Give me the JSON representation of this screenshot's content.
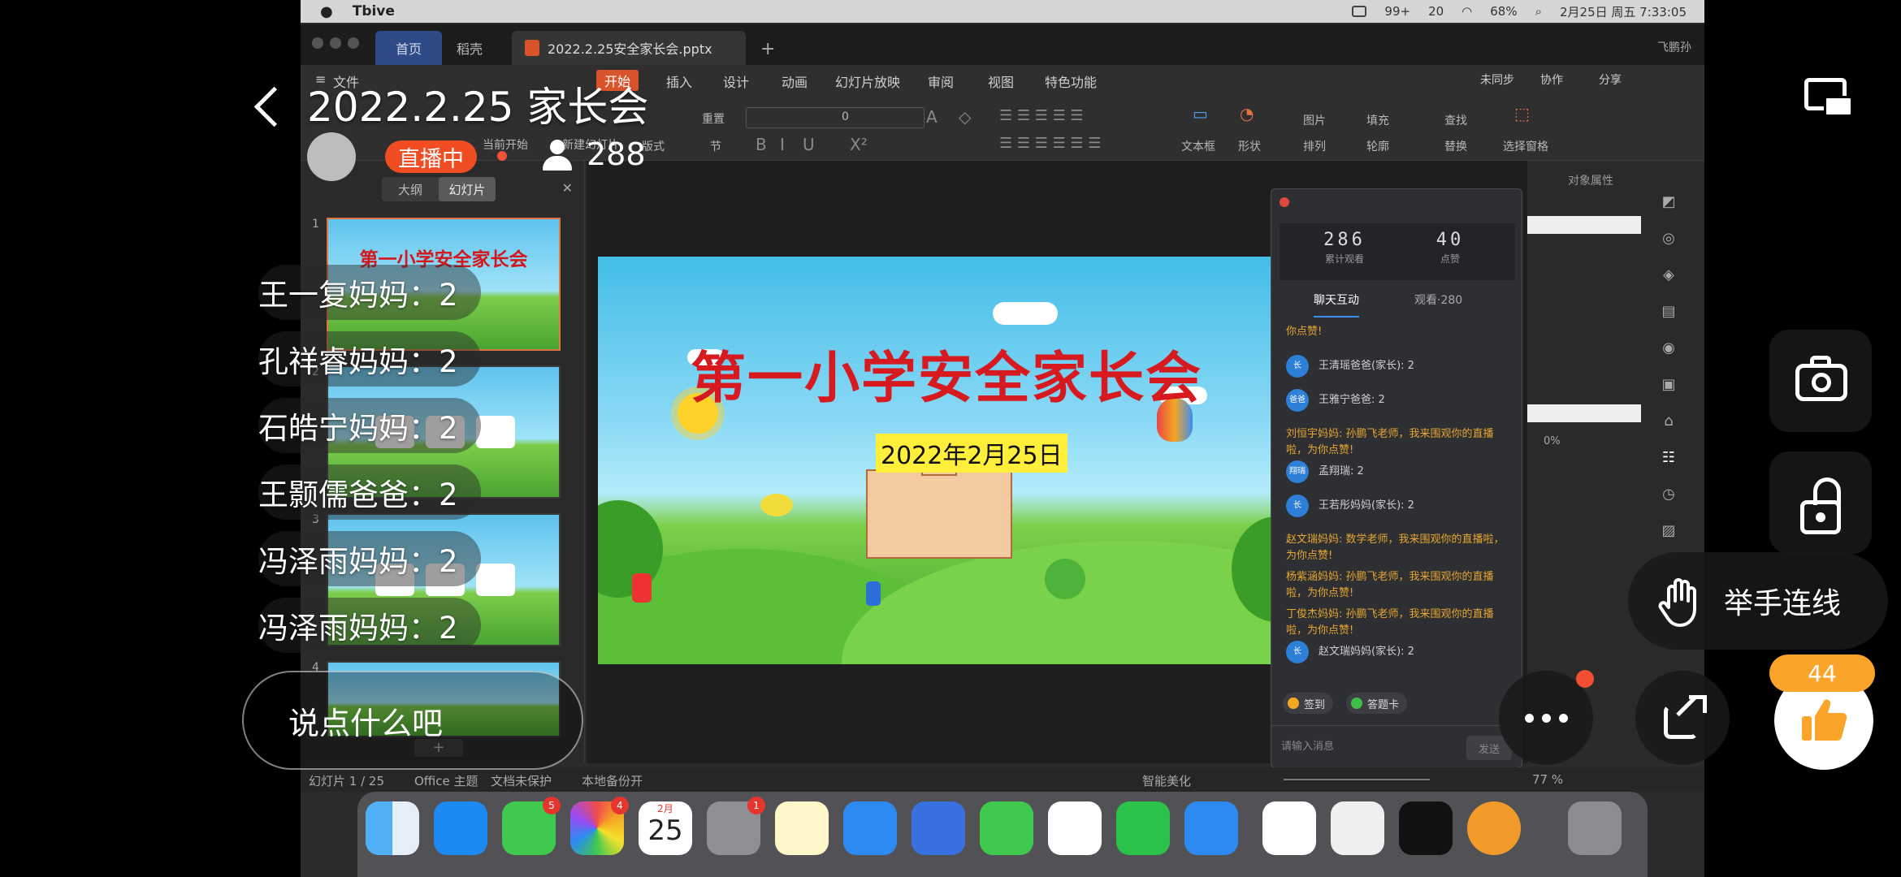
{
  "live": {
    "title": "2022.2.25 家长会",
    "status": "直播中",
    "viewers": "288",
    "like_feed": [
      "王一复妈妈：2",
      "孔祥睿妈妈：2",
      "石皓宁妈妈：2",
      "王颢儒爸爸：2",
      "冯泽雨妈妈：2",
      "冯泽雨妈妈：2"
    ],
    "comment_placeholder": "说点什么吧",
    "raise_hand_label": "举手连线",
    "like_count": "44",
    "icons": {
      "back": "chevron-left-icon",
      "viewer": "person-icon",
      "cast": "screen-cast-icon",
      "camera": "camera-icon",
      "lock": "unlock-icon",
      "hand": "raise-hand-icon",
      "more": "more-dots-icon",
      "share": "share-icon",
      "like": "thumbs-up-icon"
    },
    "colors": {
      "live_badge": "#f14d22",
      "like_badge": "#fba42a",
      "like_icon": "#fba42a"
    }
  },
  "mac": {
    "app_name": "Tbive",
    "menubar_right": [
      "99+",
      "20",
      "68%",
      "2月25日 周五 7:33:05"
    ],
    "wps": {
      "tab_home": "首页",
      "tab_store": "稻壳",
      "doc_tab": "2022.2.25安全家长会.pptx",
      "user": "飞鹏孙",
      "menu": [
        "文件",
        "开始",
        "插入",
        "设计",
        "动画",
        "幻灯片放映",
        "审阅",
        "视图",
        "特色功能"
      ],
      "menu_right": [
        "未同步",
        "协作",
        "分享"
      ],
      "ribbon_left": [
        "当前开始",
        "新建幻灯片",
        "版式",
        "重置",
        "节"
      ],
      "font_size": "0",
      "ribbon_right": [
        "文本框",
        "形状",
        "图片",
        "填充",
        "排列",
        "轮廓",
        "查找",
        "替换",
        "选择窗格"
      ],
      "pane_tabs": [
        "大纲",
        "幻灯片"
      ],
      "thumb_numbers": [
        "1",
        "2",
        "3",
        "4"
      ],
      "thumb_title": "第一小学安全家长会",
      "slide_title": "第一小学安全家长会",
      "slide_date": "2022年2月25日",
      "props_title": "对象属性",
      "props_percent": "0%",
      "status": [
        "幻灯片 1 / 25",
        "Office 主题",
        "文档未保护",
        "本地备份开",
        "智能美化",
        "77 %"
      ]
    },
    "live_panel": {
      "total_views": "286",
      "total_views_label": "累计观看",
      "likes": "40",
      "likes_label": "点赞",
      "tab_chat": "聊天互动",
      "tab_watch": "观看·280",
      "messages": [
        {
          "type": "system",
          "text": "你点赞!"
        },
        {
          "type": "user",
          "avatar": "长",
          "text": "王清瑶爸爸(家长): 2"
        },
        {
          "type": "user",
          "avatar": "爸爸",
          "text": "王雅宁爸爸: 2"
        },
        {
          "type": "system",
          "text": "刘恒宇妈妈: 孙鹏飞老师，我来围观你的直播啦，为你点赞!"
        },
        {
          "type": "user",
          "avatar": "翔瑞",
          "text": "孟翔瑞: 2"
        },
        {
          "type": "user",
          "avatar": "长",
          "text": "王若彤妈妈(家长): 2"
        },
        {
          "type": "system",
          "text": "赵文瑞妈妈: 数学老师，我来围观你的直播啦，为你点赞!"
        },
        {
          "type": "system",
          "text": "杨紫涵妈妈: 孙鹏飞老师，我来围观你的直播啦，为你点赞!"
        },
        {
          "type": "system",
          "text": "丁俊杰妈妈: 孙鹏飞老师，我来围观你的直播啦，为你点赞!"
        },
        {
          "type": "user",
          "avatar": "长",
          "text": "赵文瑞妈妈(家长): 2"
        }
      ],
      "checkin": "签到",
      "answer_card": "答题卡",
      "input_placeholder": "请输入消息",
      "send": "发送"
    },
    "dock_badges": {
      "messages": "5",
      "photos": "4",
      "calendar_month": "2月",
      "calendar_day": "25",
      "settings": "1"
    }
  }
}
